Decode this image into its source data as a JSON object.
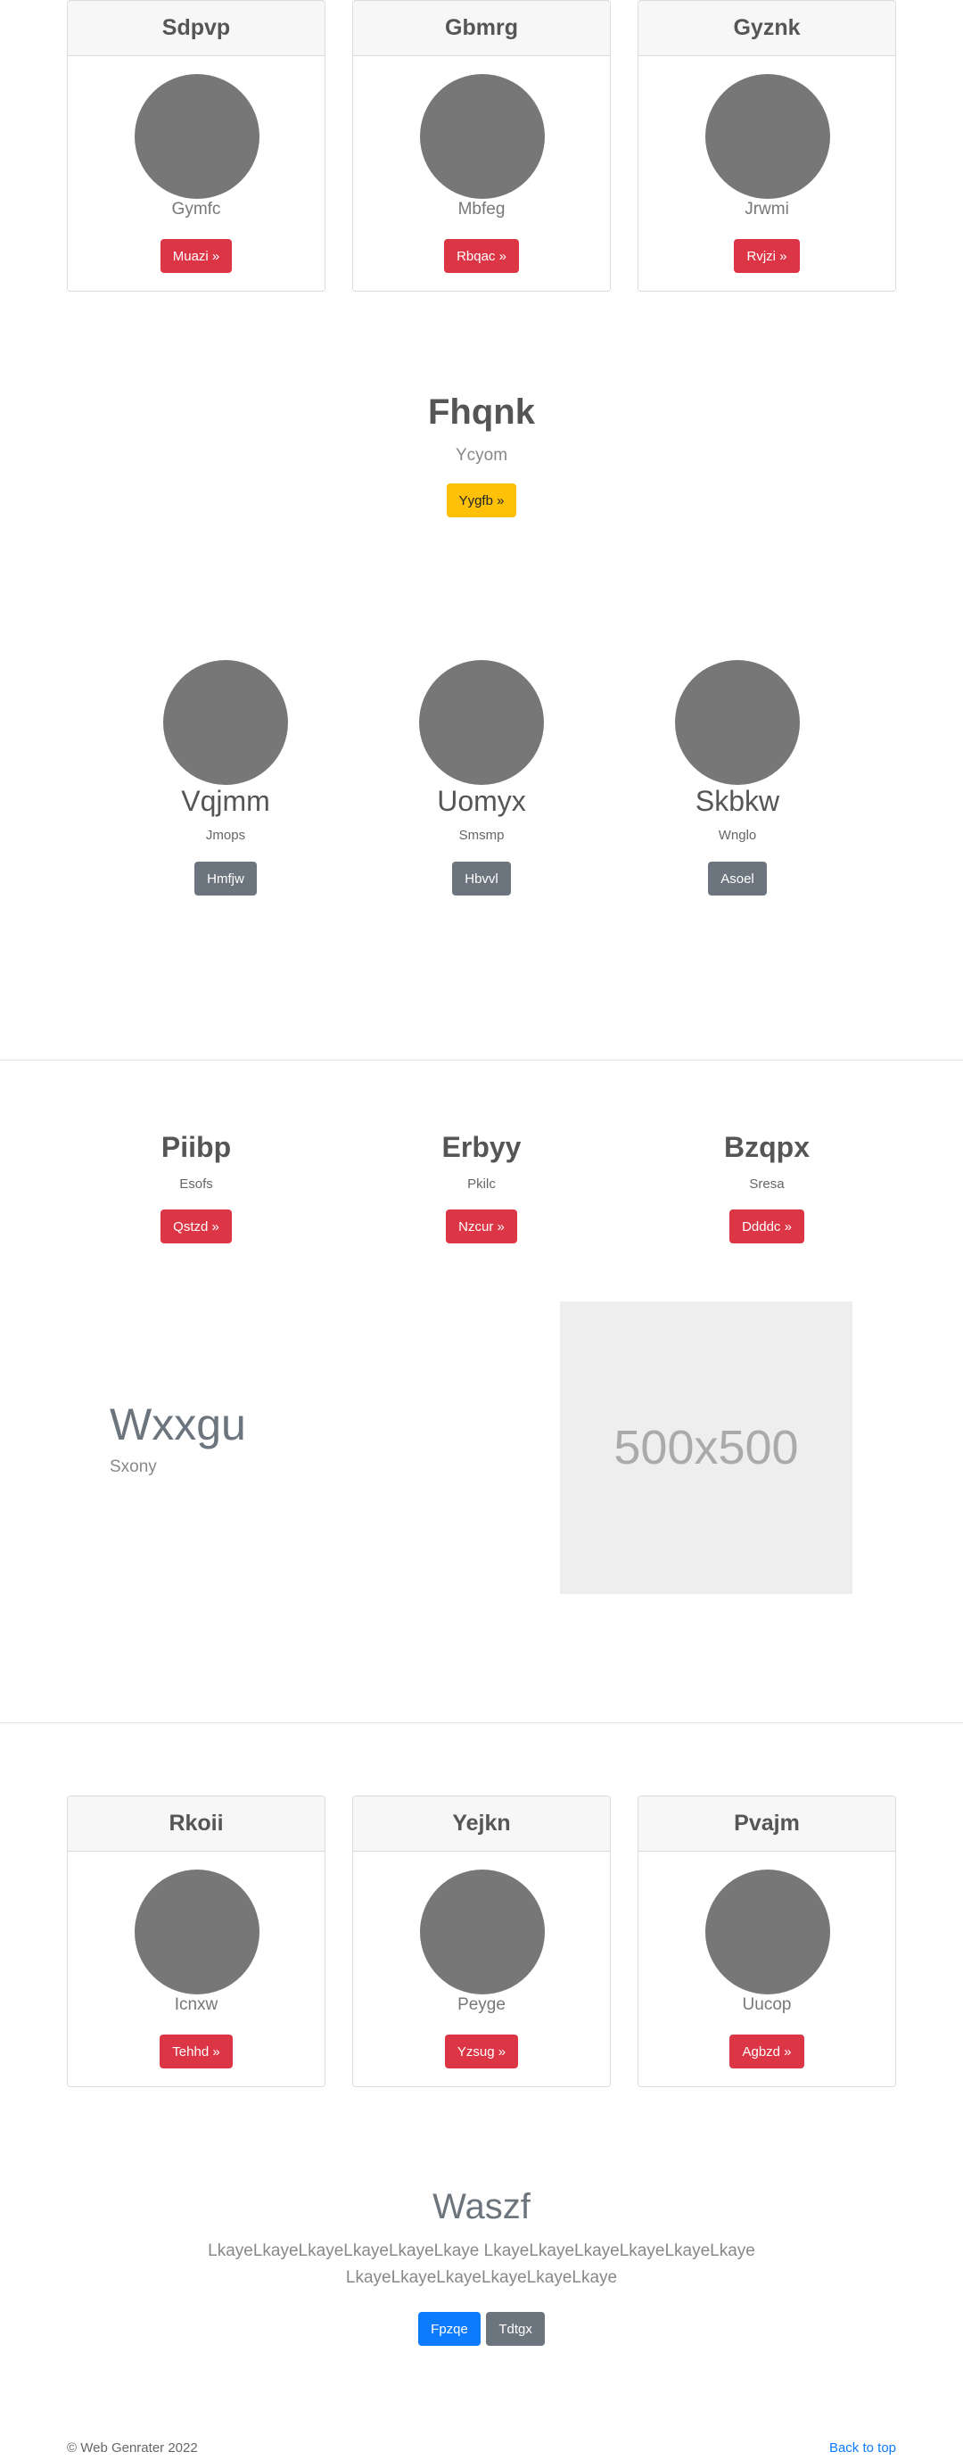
{
  "cards_top": [
    {
      "title": "Sdpvp",
      "subtitle": "Gymfc",
      "button": "Muazi »"
    },
    {
      "title": "Gbmrg",
      "subtitle": "Mbfeg",
      "button": "Rbqac »"
    },
    {
      "title": "Gyznk",
      "subtitle": "Jrwmi",
      "button": "Rvjzi »"
    }
  ],
  "hero": {
    "title": "Fhqnk",
    "subtitle": "Ycyom",
    "button": "Yygfb »"
  },
  "people": [
    {
      "name": "Vqjmm",
      "role": "Jmops",
      "button": "Hmfjw"
    },
    {
      "name": "Uomyx",
      "role": "Smsmp",
      "button": "Hbvvl"
    },
    {
      "name": "Skbkw",
      "role": "Wnglo",
      "button": "Asoel"
    }
  ],
  "features": [
    {
      "title": "Piibp",
      "subtitle": "Esofs",
      "button": "Qstzd »"
    },
    {
      "title": "Erbyy",
      "subtitle": "Pkilc",
      "button": "Nzcur »"
    },
    {
      "title": "Bzqpx",
      "subtitle": "Sresa",
      "button": "Ddddc »"
    }
  ],
  "feature_block": {
    "title": "Wxxgu",
    "subtitle": "Sxony",
    "image_label": "500x500"
  },
  "cards_bottom": [
    {
      "title": "Rkoii",
      "subtitle": "Icnxw",
      "button": "Tehhd »"
    },
    {
      "title": "Yejkn",
      "subtitle": "Peyge",
      "button": "Yzsug »"
    },
    {
      "title": "Pvajm",
      "subtitle": "Uucop",
      "button": "Agbzd »"
    }
  ],
  "cta": {
    "title": "Waszf",
    "text_line1": "LkayeLkayeLkayeLkayeLkayeLkaye LkayeLkayeLkayeLkayeLkayeLkaye",
    "text_line2": "LkayeLkayeLkayeLkayeLkayeLkaye",
    "primary_button": "Fpzqe",
    "secondary_button": "Tdtgx"
  },
  "footer": {
    "copyright": "© Web Genrater 2022",
    "back_to_top": "Back to top"
  },
  "colors": {
    "danger": "#dc3545",
    "warning": "#ffc107",
    "secondary": "#6c757d",
    "primary": "#0d7bfd",
    "placeholder": "#777777"
  }
}
